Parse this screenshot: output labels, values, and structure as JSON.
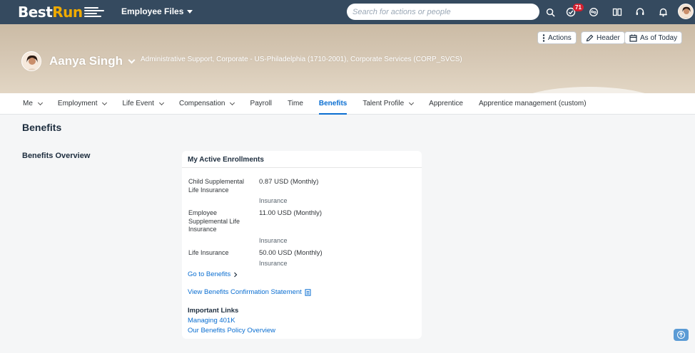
{
  "shell": {
    "logo_best": "Best",
    "logo_run": "Run",
    "app_menu": "Employee Files",
    "search_placeholder": "Search for actions or people",
    "notification_count": "71",
    "icons": [
      "search-icon",
      "approvals-icon",
      "chat-icon",
      "compare-icon",
      "support-icon",
      "bell-icon",
      "user-avatar"
    ]
  },
  "header": {
    "buttons": {
      "actions": "Actions",
      "header": "Header",
      "as_of_today": "As of Today"
    },
    "person_name": "Aanya Singh",
    "org_line": "Administrative Support, Corporate - US-Philadelphia (1710-2001), Corporate Services (CORP_SVCS)"
  },
  "tabs": [
    {
      "label": "Me",
      "dropdown": true
    },
    {
      "label": "Employment",
      "dropdown": true
    },
    {
      "label": "Life Event",
      "dropdown": true
    },
    {
      "label": "Compensation",
      "dropdown": true
    },
    {
      "label": "Payroll",
      "dropdown": false
    },
    {
      "label": "Time",
      "dropdown": false
    },
    {
      "label": "Benefits",
      "dropdown": false,
      "active": true
    },
    {
      "label": "Talent Profile",
      "dropdown": true
    },
    {
      "label": "Apprentice",
      "dropdown": false
    },
    {
      "label": "Apprentice management (custom)",
      "dropdown": false
    }
  ],
  "main": {
    "page_title": "Benefits",
    "section_title": "Benefits Overview",
    "card": {
      "title": "My Active Enrollments",
      "enrollments": [
        {
          "name": "Child Supplemental Life Insurance",
          "amount": "0.87 USD (Monthly)",
          "type": "Insurance"
        },
        {
          "name": "Employee Supplemental Life Insurance",
          "amount": "11.00 USD (Monthly)",
          "type": "Insurance"
        },
        {
          "name": "Life Insurance",
          "amount": "50.00 USD (Monthly)",
          "type": "Insurance"
        }
      ],
      "go_to_benefits": "Go to Benefits",
      "confirmation_link": "View Benefits Confirmation Statement",
      "important_links_title": "Important Links",
      "important_links": [
        "Managing 401K",
        "Our Benefits Policy Overview"
      ]
    }
  },
  "colors": {
    "shell": "#354a5f",
    "accent": "#0a6ed1",
    "brand_run": "#f0ab00",
    "badge": "#d32030"
  }
}
